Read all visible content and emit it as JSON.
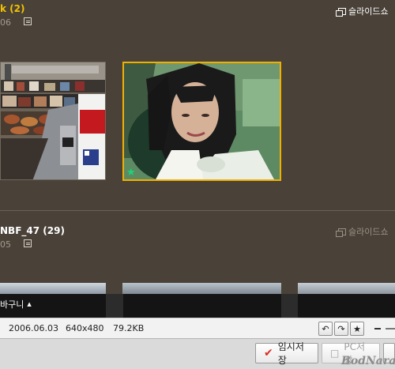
{
  "albums": [
    {
      "title": "k (2)",
      "date": "06",
      "slideshow_label": "슬라이드쇼",
      "thumbnails": [
        {
          "name": "market-stall-photo",
          "selected": false
        },
        {
          "name": "woman-portrait-photo",
          "selected": true,
          "starred": true
        }
      ]
    },
    {
      "title": "NBF_47 (29)",
      "date": "05",
      "slideshow_label": "슬라이드쇼"
    }
  ],
  "tray": {
    "label": "바구니",
    "toggle_icon": "caret-up"
  },
  "status": {
    "date": "2006.06.03",
    "dimensions": "640x480",
    "size": "79.2KB"
  },
  "toolbar": {
    "rotate_left_icon": "rotate-left",
    "rotate_right_icon": "rotate-right",
    "star_icon": "star"
  },
  "actions": {
    "temp_save_label": "임시저장",
    "pc_save_label": "PC저장"
  },
  "watermark": "BodNara",
  "colors": {
    "background": "#4a4239",
    "album_title_highlight": "#f2c200",
    "selected_border": "#f0b000",
    "star": "#1ed37a",
    "save_check": "#d93025"
  }
}
